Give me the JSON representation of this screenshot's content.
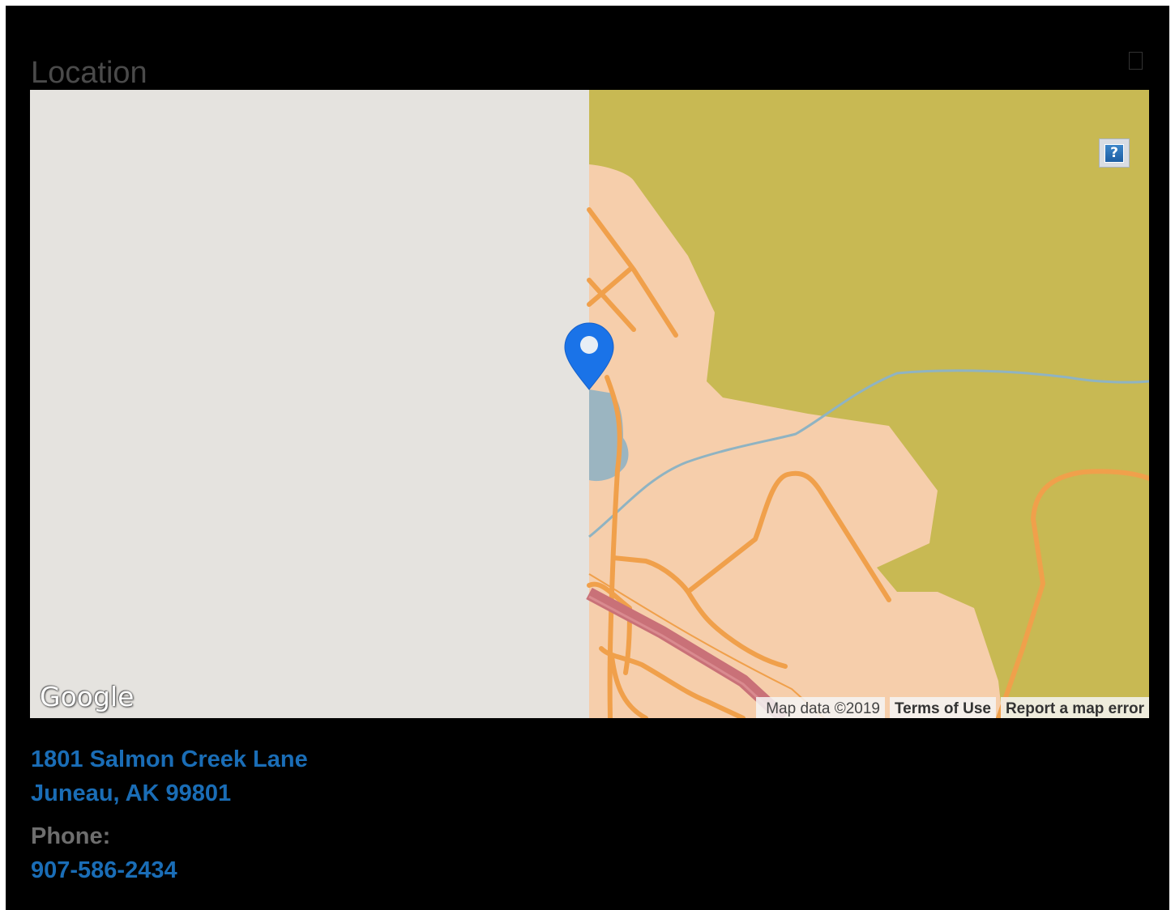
{
  "section": {
    "title": "Location"
  },
  "map": {
    "help_button_label": "?",
    "google_logo_text": "Google",
    "attribution": {
      "map_data": "Map data ©2019",
      "terms": "Terms of Use",
      "report": "Report a map error"
    },
    "marker_icon": "map-pin-icon",
    "colors": {
      "unloaded_tile": "#e5e3df",
      "forest": "#c8b953",
      "land": "#f6ceab",
      "road": "#f0a04b",
      "highway": "#c97178",
      "water": "#9bb5c1",
      "marker": "#1a73e8"
    }
  },
  "address": {
    "line1": "1801 Salmon Creek Lane",
    "line2": "Juneau, AK 99801"
  },
  "phone": {
    "label": "Phone:",
    "value": "907-586-2434"
  }
}
